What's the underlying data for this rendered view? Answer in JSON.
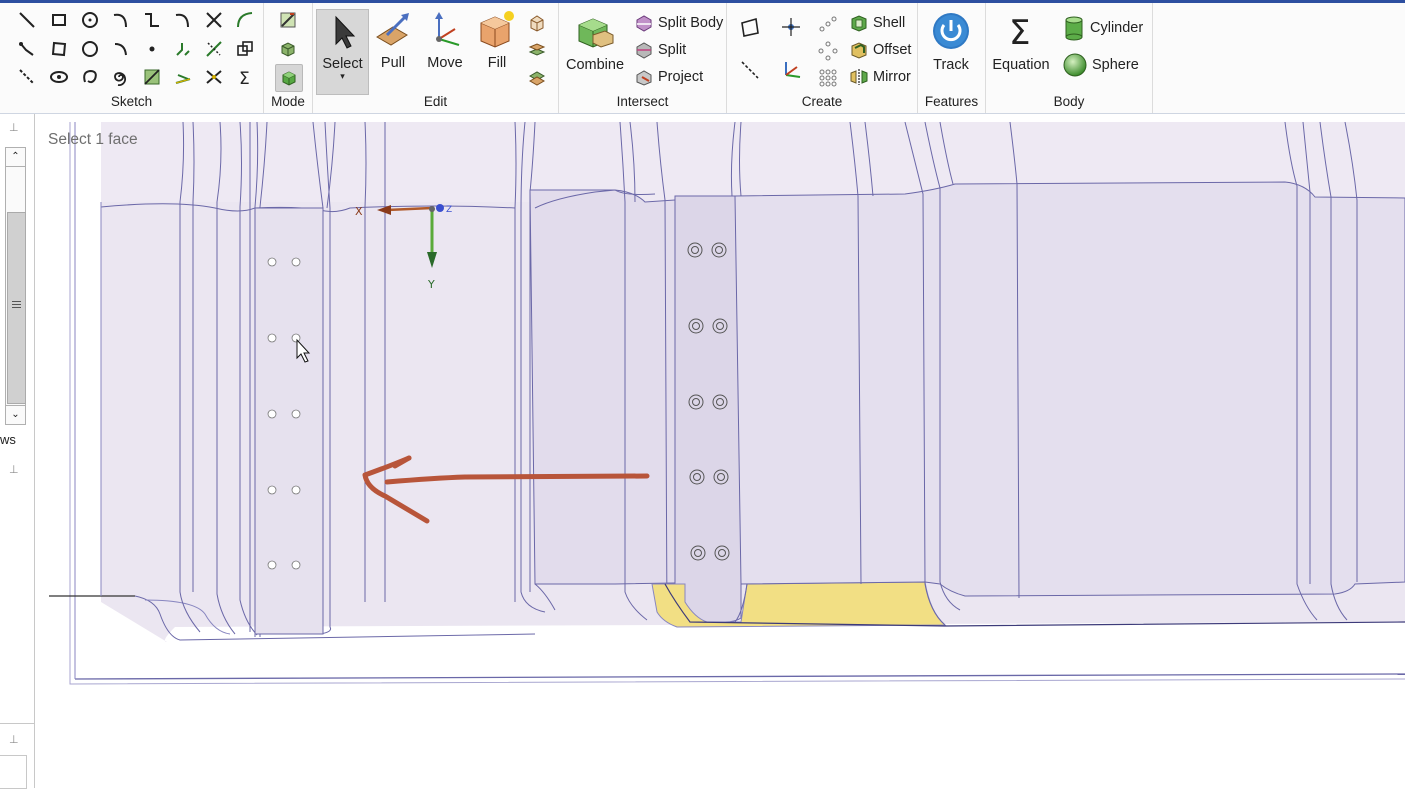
{
  "ribbon": {
    "groups": {
      "sketch": "Sketch",
      "mode": "Mode",
      "edit": "Edit",
      "intersect": "Intersect",
      "create": "Create",
      "features": "Features",
      "body": "Body"
    },
    "edit": {
      "select": "Select",
      "pull": "Pull",
      "move": "Move",
      "fill": "Fill"
    },
    "intersect": {
      "combine": "Combine",
      "split_body": "Split Body",
      "split": "Split",
      "project": "Project"
    },
    "create": {
      "shell": "Shell",
      "offset": "Offset",
      "mirror": "Mirror"
    },
    "features": {
      "track": "Track"
    },
    "body": {
      "equation": "Equation",
      "cylinder": "Cylinder",
      "sphere": "Sphere"
    }
  },
  "left_panel": {
    "views_label": "ws"
  },
  "viewport": {
    "hint": "Select 1 face",
    "axis_x": "X",
    "axis_y": "Y",
    "axis_z": "Z",
    "highlight_color": "#f2df84",
    "annotation_color": "#b8553a"
  }
}
